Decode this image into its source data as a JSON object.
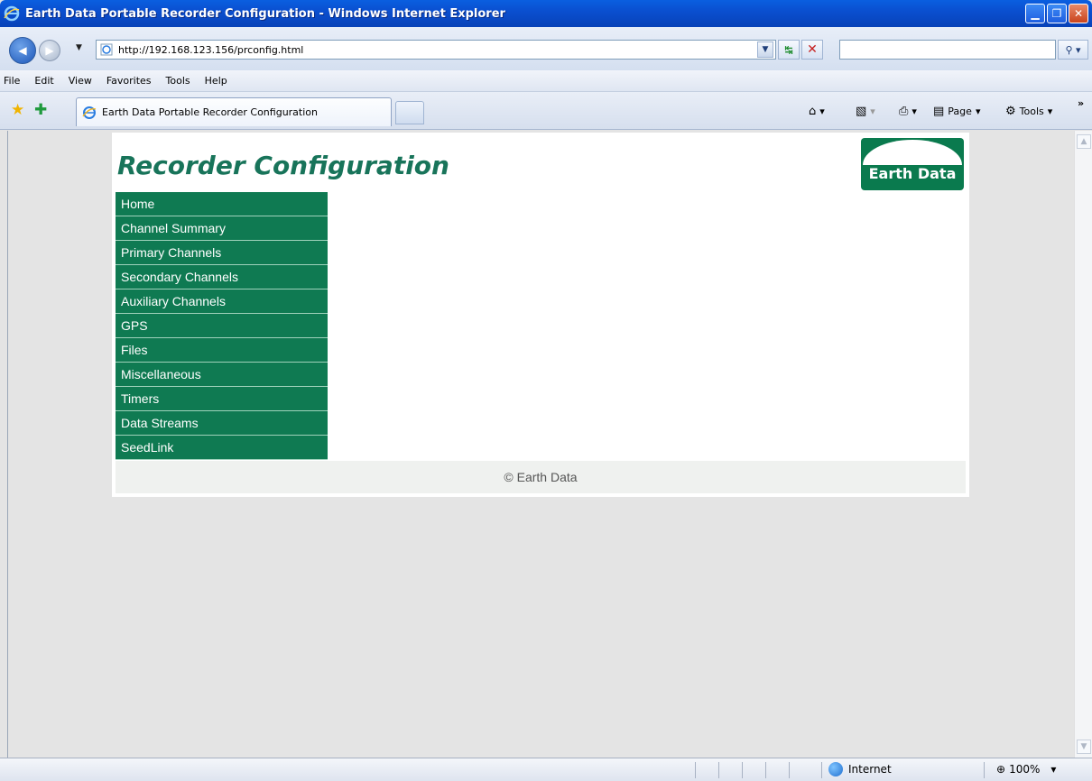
{
  "window": {
    "title": "Earth Data Portable Recorder Configuration - Windows Internet Explorer"
  },
  "address": {
    "url": "http://192.168.123.156/prconfig.html"
  },
  "menubar": {
    "items": [
      "File",
      "Edit",
      "View",
      "Favorites",
      "Tools",
      "Help"
    ]
  },
  "tabs": {
    "active_label": "Earth Data Portable Recorder Configuration"
  },
  "commandbar": {
    "page_label": "Page",
    "tools_label": "Tools"
  },
  "page": {
    "title": "Recorder Configuration",
    "logo_text": "Earth Data",
    "nav": [
      "Home",
      "Channel Summary",
      "Primary Channels",
      "Secondary Channels",
      "Auxiliary Channels",
      "GPS",
      "Files",
      "Miscellaneous",
      "Timers",
      "Data Streams",
      "SeedLink"
    ],
    "footer": "© Earth Data"
  },
  "status": {
    "zone": "Internet",
    "zoom": "100%"
  },
  "colors": {
    "nav_bg": "#0f7a52",
    "title": "#18745a",
    "titlebar": "#0a4fd0"
  }
}
